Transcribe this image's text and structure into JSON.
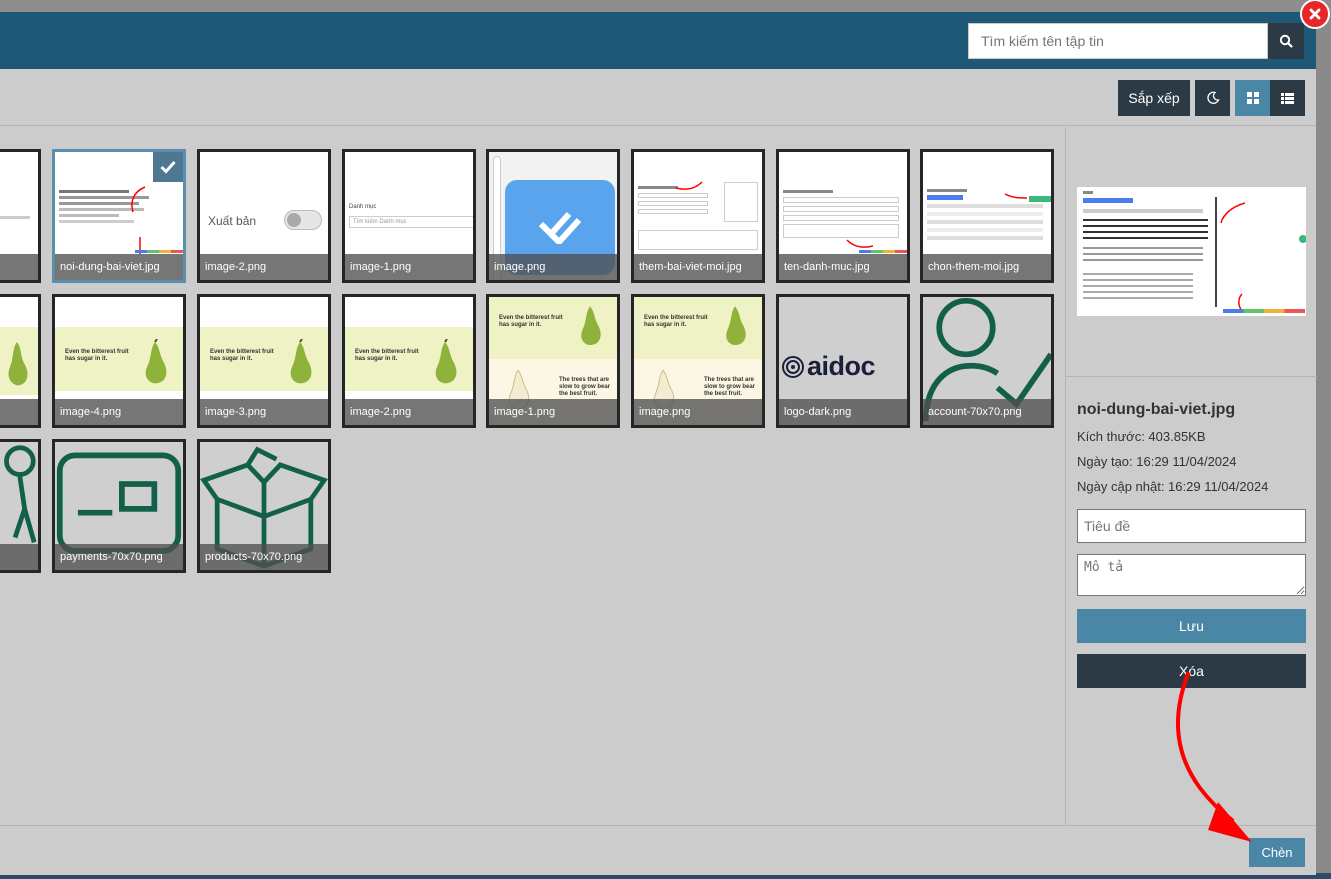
{
  "search": {
    "placeholder": "Tìm kiếm tên tập tin"
  },
  "toolbar": {
    "sort_label": "Sắp xếp"
  },
  "files": [
    {
      "name": "noi-dung-bai-viet.jpg",
      "selected": true,
      "kind": "screenshot"
    },
    {
      "name": "image-2.png",
      "kind": "toggle",
      "thumb_text": "Xuất bản"
    },
    {
      "name": "image-1.png",
      "kind": "category",
      "thumb_label": "Danh mục",
      "thumb_placeholder": "Tìm kiếm Danh mục"
    },
    {
      "name": "image.png",
      "kind": "check-icon"
    },
    {
      "name": "them-bai-viet-moi.jpg",
      "kind": "screenshot"
    },
    {
      "name": "ten-danh-muc.jpg",
      "kind": "screenshot"
    },
    {
      "name": "chon-them-moi.jpg",
      "kind": "screenshot"
    },
    {
      "name": "image-4.png",
      "kind": "pear",
      "quote": "Even the bitterest fruit has sugar in it."
    },
    {
      "name": "image-3.png",
      "kind": "pear",
      "quote": "Even the bitterest fruit has sugar in it."
    },
    {
      "name": "image-2.png",
      "kind": "pear",
      "quote": "Even the bitterest fruit has sugar in it."
    },
    {
      "name": "image-1.png",
      "kind": "pear-double",
      "quote": "Even the bitterest fruit has sugar in it.",
      "quote2": "The trees that are slow to grow bear the best fruit."
    },
    {
      "name": "image.png",
      "kind": "pear-double",
      "quote": "Even the bitterest fruit has sugar in it.",
      "quote2": "The trees that are slow to grow bear the best fruit."
    },
    {
      "name": "logo-dark.png",
      "kind": "logo",
      "logo_text": "aidoc"
    },
    {
      "name": "account-70x70.png",
      "kind": "account-icon"
    },
    {
      "name": "payments-70x70.png",
      "kind": "payment-icon"
    },
    {
      "name": "products-70x70.png",
      "kind": "box-icon"
    }
  ],
  "details": {
    "file_name": "noi-dung-bai-viet.jpg",
    "size": "Kích thước: 403.85KB",
    "created": "Ngày tạo: 16:29 11/04/2024",
    "updated": "Ngày cập nhật: 16:29 11/04/2024",
    "title_placeholder": "Tiêu đề",
    "desc_placeholder": "Mô tả",
    "save_label": "Lưu",
    "delete_label": "Xóa"
  },
  "footer": {
    "insert_label": "Chèn"
  },
  "colors": {
    "header": "#1f5877",
    "accent": "#4a86a6",
    "dark_button": "#2b3a44",
    "close": "#e62727",
    "annotation": "#ff0000"
  }
}
